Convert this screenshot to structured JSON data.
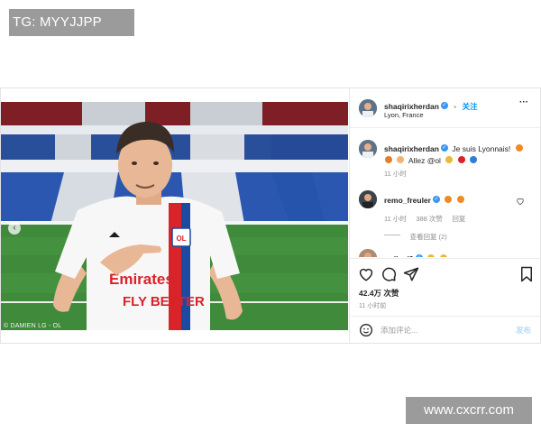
{
  "watermarks": {
    "top_left": "TG: MYYJJPP",
    "bottom_right": "www.cxcrr.com"
  },
  "photo": {
    "credit": "© DAMIEN LG - OL"
  },
  "header": {
    "username": "shaqirixherdan",
    "follow_label": "关注",
    "more_label": "···",
    "location": "Lyon, France"
  },
  "caption": {
    "username": "shaqirixherdan",
    "text_line1": "Je suis Lyonnais!",
    "text_line2": "Allez @ol",
    "time": "11 小时"
  },
  "comments": [
    {
      "username": "remo_freuler",
      "time": "11 小时",
      "likes": "388 次赞",
      "reply_label": "回复",
      "view_replies": "查看回复 (2)"
    },
    {
      "username": "ardlanl9"
    }
  ],
  "actions": {
    "likes": "42.4万 次赞",
    "time": "11 小时前"
  },
  "add_comment": {
    "placeholder": "添加评论...",
    "post_label": "发布"
  },
  "colors": {
    "accent": "#0095f6",
    "verified": "#3897f0",
    "text": "#262626",
    "muted": "#8e8e8e",
    "fire": "#f08a24",
    "lyon_red": "#d8232a",
    "lyon_blue": "#1c4aa0"
  },
  "icons": [
    "heart-icon",
    "comment-icon",
    "share-icon",
    "bookmark-icon",
    "emoji-icon",
    "verified-icon",
    "more-icon",
    "carousel-left-icon"
  ]
}
